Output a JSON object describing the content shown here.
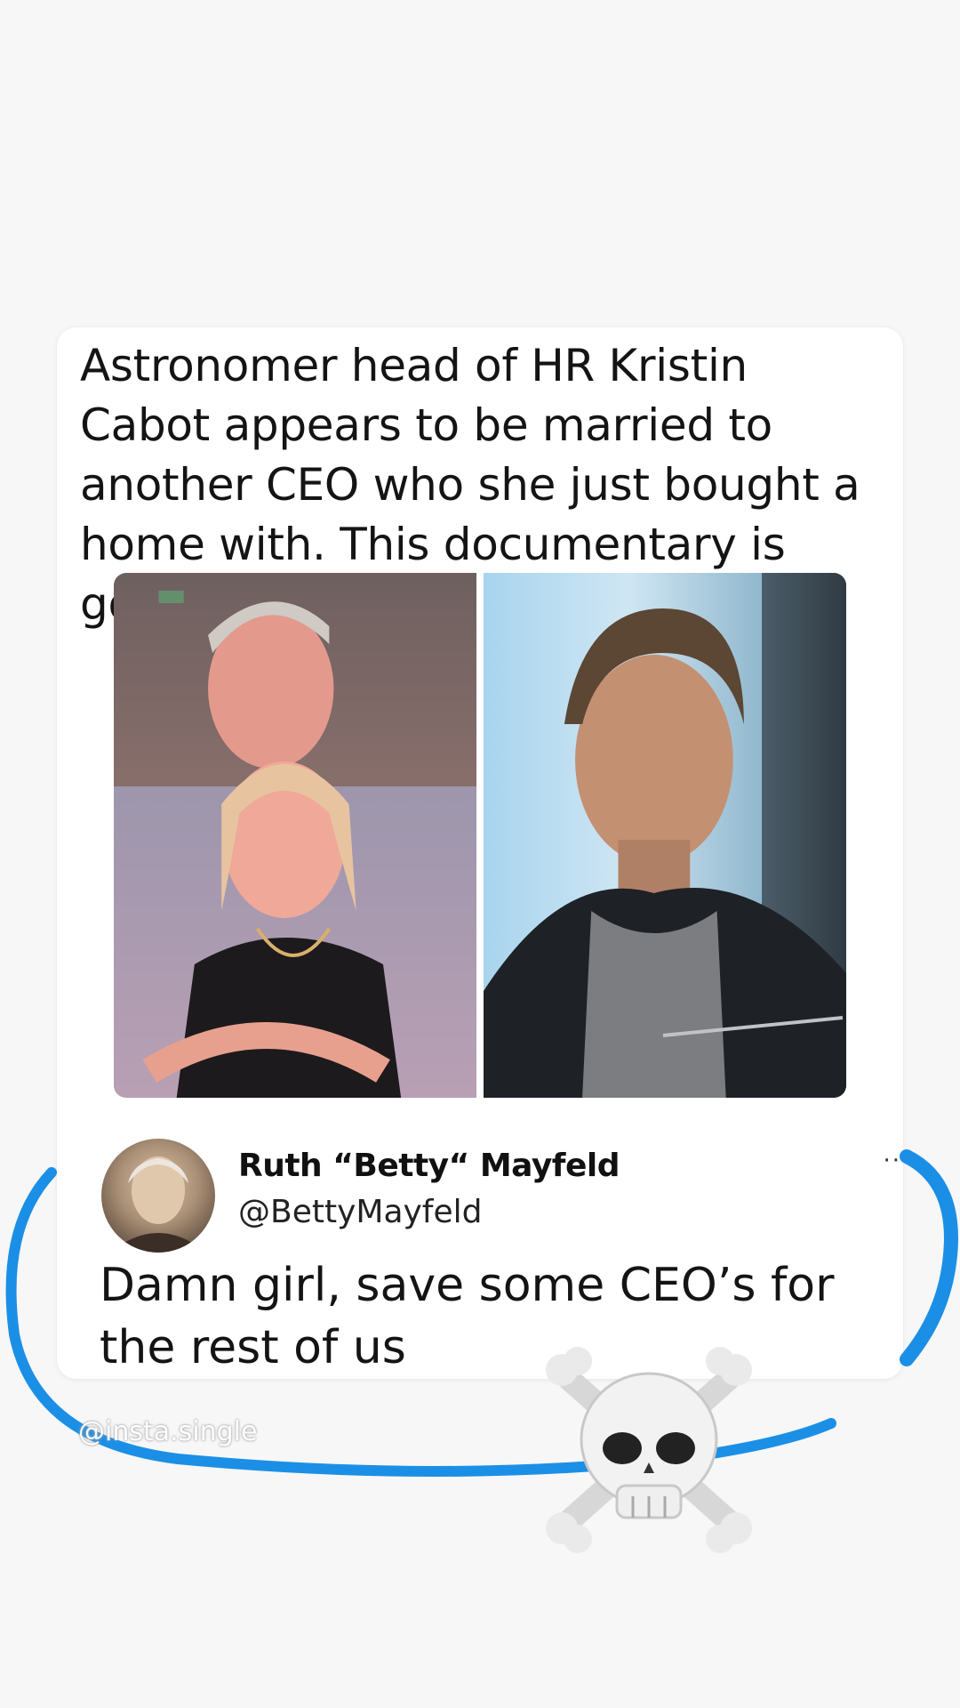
{
  "post": {
    "text": "Astronomer head of HR Kristin Cabot appears to be married to another CEO who she just bought a home with. This documentary is gonna be good"
  },
  "reply": {
    "author_name": "Ruth “Betty“ Mayfeld",
    "author_handle": "@BettyMayfeld",
    "more": "··",
    "text": "Damn girl, save some CEO’s for the rest of us"
  },
  "overlay": {
    "watermark": "@insta.single",
    "scribble_color": "#1b8fe6",
    "sticker": "skull-crossbones-emoji"
  }
}
